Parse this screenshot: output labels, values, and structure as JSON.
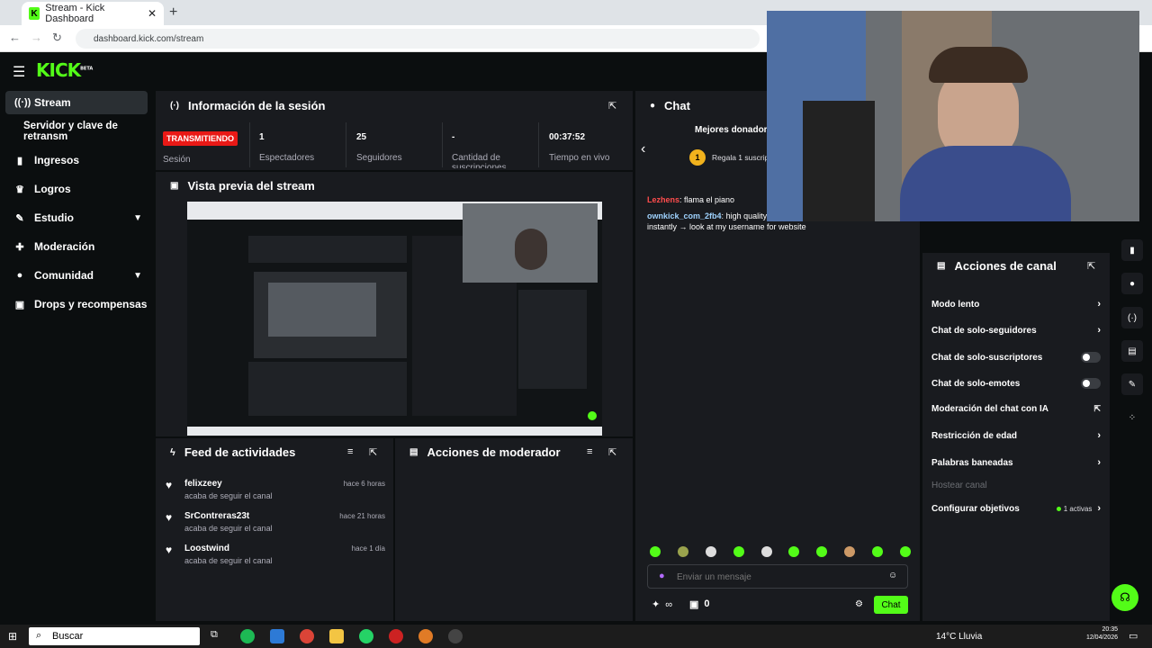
{
  "browser": {
    "tab_title": "Stream - Kick Dashboard",
    "url": "dashboard.kick.com/stream"
  },
  "logo": {
    "text": "KICK",
    "badge": "BETA"
  },
  "sidebar": {
    "items": [
      {
        "label": "Stream",
        "icon": "broadcast-icon"
      },
      {
        "label": "Servidor y clave de retransm",
        "icon": ""
      },
      {
        "label": "Ingresos",
        "icon": "chart-icon"
      },
      {
        "label": "Logros",
        "icon": "trophy-icon"
      },
      {
        "label": "Estudio",
        "icon": "wand-icon"
      },
      {
        "label": "Moderación",
        "icon": "wrench-icon"
      },
      {
        "label": "Comunidad",
        "icon": "user-icon"
      },
      {
        "label": "Drops y recompensas",
        "icon": "gift-icon"
      }
    ]
  },
  "session": {
    "title": "Información de la sesión",
    "status": "TRANSMITIENDO",
    "status_label": "Sesión",
    "stats": [
      {
        "value": "1",
        "label": "Espectadores"
      },
      {
        "value": "25",
        "label": "Seguidores"
      },
      {
        "value": "-",
        "label": "Cantidad de suscripciones"
      },
      {
        "value": "00:37:52",
        "label": "Tiempo en vivo"
      }
    ]
  },
  "preview": {
    "title": "Vista previa del stream"
  },
  "feed": {
    "title": "Feed de actividades",
    "items": [
      {
        "name": "felixzeey",
        "action": "acaba de seguir el canal",
        "time": "hace 6 horas"
      },
      {
        "name": "SrContreras23t",
        "action": "acaba de seguir el canal",
        "time": "hace 21 horas"
      },
      {
        "name": "Loostwind",
        "action": "acaba de seguir el canal",
        "time": "hace 1 día"
      }
    ]
  },
  "mod_actions": {
    "title": "Acciones de moderador"
  },
  "chat": {
    "title": "Chat",
    "top_donors": "Mejores donadores",
    "gift_rank": "1",
    "gift_text": "Regala 1 suscrip",
    "messages": [
      {
        "user": "Lezhens",
        "text": "flama el piano",
        "color": "#ff4d4d"
      },
      {
        "user": "ownkick_com_2fb4",
        "text": "high quality usernames grow your presence instantly → look at my username for website",
        "color": "#9fd3ff"
      }
    ],
    "input_placeholder": "Enviar un mensaje",
    "infinity": "∞",
    "count": "0",
    "send": "Chat"
  },
  "channel_actions": {
    "title": "Acciones de canal",
    "items": [
      {
        "label": "Modo lento",
        "type": "chevron"
      },
      {
        "label": "Chat de solo-seguidores",
        "type": "chevron"
      },
      {
        "label": "Chat de solo-suscriptores",
        "type": "toggle"
      },
      {
        "label": "Chat de solo-emotes",
        "type": "toggle"
      },
      {
        "label": "Moderación del chat con IA",
        "type": "external"
      },
      {
        "label": "Restricción de edad",
        "type": "chevron"
      },
      {
        "label": "Palabras baneadas",
        "type": "chevron"
      },
      {
        "label": "Hostear canal",
        "type": "disabled"
      },
      {
        "label": "Configurar objetivos",
        "type": "badge",
        "badge": "1 activas"
      }
    ]
  },
  "taskbar": {
    "search": "Buscar",
    "weather": "14°C  Lluvia",
    "time": "20:35",
    "date": "12/04/2026"
  },
  "colors": {
    "accent": "#53fc18",
    "live": "#e91916",
    "panel": "#191b1f",
    "bg": "#0b0e0f"
  }
}
